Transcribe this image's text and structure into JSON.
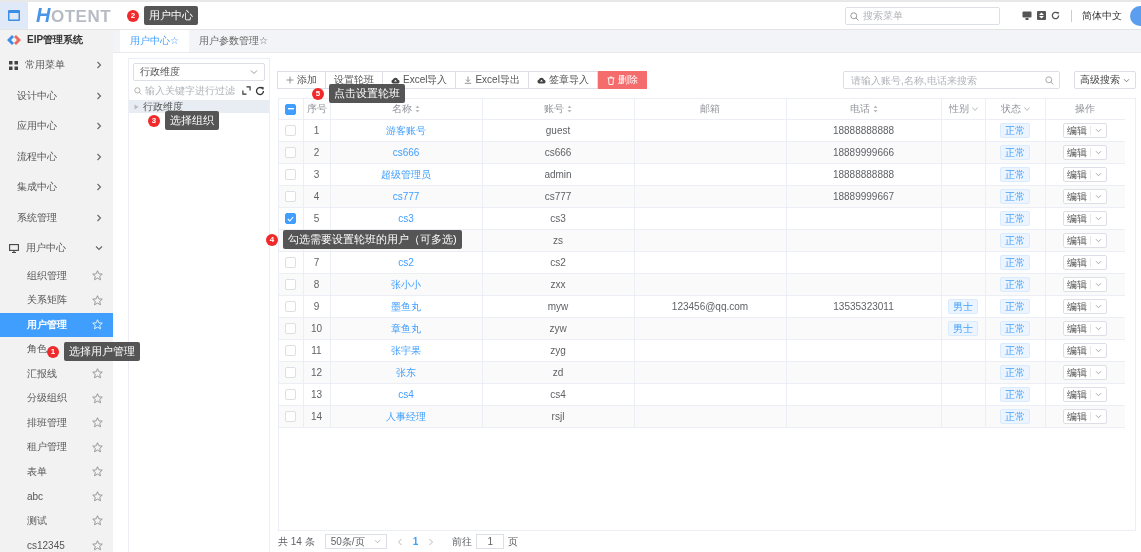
{
  "header": {
    "logo_initial": "H",
    "logo_rest": "OTENT",
    "search_placeholder": "搜索菜单",
    "language": "简体中文"
  },
  "sidebar": {
    "title": "EIP管理系统",
    "menus": [
      {
        "label": "常用菜单",
        "kind": "grid",
        "expanded": false
      },
      {
        "label": "设计中心",
        "kind": "plain",
        "expanded": false
      },
      {
        "label": "应用中心",
        "kind": "plain",
        "expanded": false
      },
      {
        "label": "流程中心",
        "kind": "plain",
        "expanded": false
      },
      {
        "label": "集成中心",
        "kind": "plain",
        "expanded": false
      },
      {
        "label": "系统管理",
        "kind": "plain",
        "expanded": false
      },
      {
        "label": "用户中心",
        "kind": "monitor",
        "expanded": true,
        "children": [
          {
            "label": "组织管理",
            "selected": false,
            "favorite_icon": true
          },
          {
            "label": "关系矩阵",
            "selected": false,
            "favorite_icon": true
          },
          {
            "label": "用户管理",
            "selected": true,
            "favorite_icon": true
          },
          {
            "label": "角色",
            "selected": false
          },
          {
            "label": "汇报线",
            "selected": false,
            "favorite_icon": true
          },
          {
            "label": "分级组织",
            "selected": false,
            "favorite_icon": true
          },
          {
            "label": "排班管理",
            "selected": false,
            "favorite_icon": true
          },
          {
            "label": "租户管理",
            "selected": false,
            "favorite_icon": true
          },
          {
            "label": "表单",
            "selected": false,
            "favorite_icon": true
          },
          {
            "label": "abc",
            "selected": false,
            "favorite_icon": true
          },
          {
            "label": "测试",
            "selected": false,
            "favorite_icon": true
          },
          {
            "label": "cs12345",
            "selected": false,
            "favorite_icon": true
          }
        ]
      }
    ]
  },
  "tabs": [
    {
      "label": "用户中心☆",
      "selected": true
    },
    {
      "label": "用户参数管理☆",
      "selected": false
    }
  ],
  "tree_panel": {
    "dimension": "行政维度",
    "filter_placeholder": "输入关键字进行过滤",
    "nodes": [
      {
        "label": "行政维度",
        "selected": true
      }
    ]
  },
  "toolbar": {
    "buttons": [
      {
        "label": "添加",
        "kind": "add"
      },
      {
        "label": "设置轮班",
        "kind": "plain"
      },
      {
        "label": "Excel导入",
        "kind": "upload"
      },
      {
        "label": "Excel导出",
        "kind": "download"
      },
      {
        "label": "签章导入",
        "kind": "upload"
      },
      {
        "label": "删除",
        "kind": "danger"
      }
    ],
    "search_placeholder": "请输入账号,名称,电话来搜索",
    "advanced_search": "高级搜索"
  },
  "table": {
    "header_checkbox": {
      "indeterminate": true
    },
    "columns": [
      {
        "label": "序号",
        "sortable": false,
        "filterable": false
      },
      {
        "label": "名称",
        "sortable": true,
        "filterable": false
      },
      {
        "label": "账号",
        "sortable": true,
        "filterable": false
      },
      {
        "label": "邮箱",
        "sortable": false,
        "filterable": false
      },
      {
        "label": "电话",
        "sortable": true,
        "filterable": false
      },
      {
        "label": "性别",
        "sortable": false,
        "filterable": true
      },
      {
        "label": "状态",
        "sortable": false,
        "filterable": true
      },
      {
        "label": "操作",
        "sortable": false,
        "filterable": false
      }
    ],
    "rows": [
      {
        "no": "1",
        "name": "游客账号",
        "account": "guest",
        "phone": "18888888888",
        "status": "正常",
        "action": "编辑",
        "checked": false
      },
      {
        "no": "2",
        "name": "cs666",
        "account": "cs666",
        "phone": "18889999666",
        "status": "正常",
        "action": "编辑",
        "checked": false
      },
      {
        "no": "3",
        "name": "超级管理员",
        "account": "admin",
        "phone": "18888888888",
        "status": "正常",
        "action": "编辑",
        "checked": false
      },
      {
        "no": "4",
        "name": "cs777",
        "account": "cs777",
        "phone": "18889999667",
        "status": "正常",
        "action": "编辑",
        "checked": false
      },
      {
        "no": "5",
        "name": "cs3",
        "account": "cs3",
        "status": "正常",
        "action": "编辑",
        "checked": true
      },
      {
        "account": "zs",
        "status": "正常",
        "action": "编辑"
      },
      {
        "no": "7",
        "name": "cs2",
        "account": "cs2",
        "status": "正常",
        "action": "编辑",
        "checked": false
      },
      {
        "no": "8",
        "name": "张小小",
        "account": "zxx",
        "status": "正常",
        "action": "编辑",
        "checked": false
      },
      {
        "no": "9",
        "name": "墨鱼丸",
        "account": "myw",
        "email": "123456@qq.com",
        "phone": "13535323011",
        "gender": "男士",
        "status": "正常",
        "action": "编辑",
        "checked": false
      },
      {
        "no": "10",
        "name": "章鱼丸",
        "account": "zyw",
        "gender": "男士",
        "status": "正常",
        "action": "编辑",
        "checked": false
      },
      {
        "no": "11",
        "name": "张宇果",
        "account": "zyg",
        "status": "正常",
        "action": "编辑",
        "checked": false
      },
      {
        "no": "12",
        "name": "张东",
        "account": "zd",
        "status": "正常",
        "action": "编辑",
        "checked": false
      },
      {
        "no": "13",
        "name": "cs4",
        "account": "cs4",
        "status": "正常",
        "action": "编辑",
        "checked": false
      },
      {
        "no": "14",
        "name": "人事经理",
        "account": "rsjl",
        "status": "正常",
        "action": "编辑",
        "checked": false
      }
    ]
  },
  "pagination": {
    "total": "共 14 条",
    "page_size": "50条/页",
    "pages": [
      {
        "label": "1",
        "selected": true
      }
    ],
    "goto_label": "前往",
    "goto_value": "1",
    "goto_suffix": "页"
  },
  "callouts": [
    {
      "number": "2",
      "text": "用户中心"
    },
    {
      "number": "5",
      "text": "点击设置轮班"
    },
    {
      "number": "3",
      "text": "选择组织"
    },
    {
      "number": "4",
      "text": "勾选需要设置轮班的用户（可多选)"
    },
    {
      "number": "1",
      "text": "选择用户管理"
    }
  ]
}
